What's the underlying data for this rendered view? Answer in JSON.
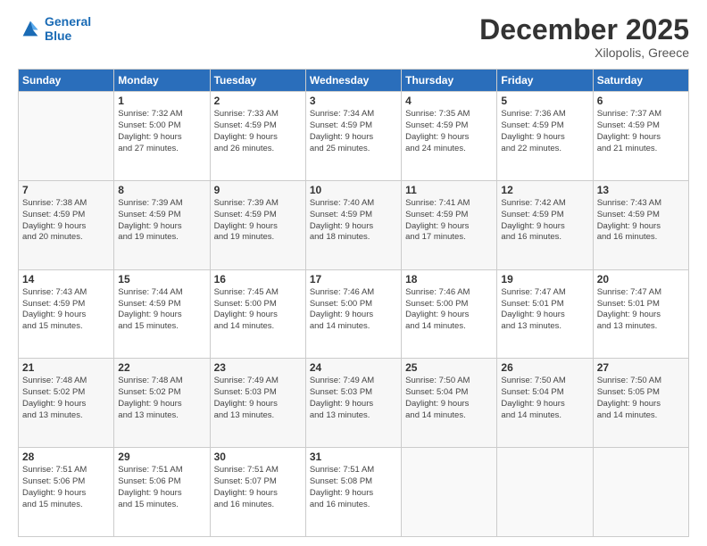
{
  "header": {
    "logo_line1": "General",
    "logo_line2": "Blue",
    "month": "December 2025",
    "location": "Xilopolis, Greece"
  },
  "days_of_week": [
    "Sunday",
    "Monday",
    "Tuesday",
    "Wednesday",
    "Thursday",
    "Friday",
    "Saturday"
  ],
  "weeks": [
    [
      {
        "day": "",
        "info": ""
      },
      {
        "day": "1",
        "info": "Sunrise: 7:32 AM\nSunset: 5:00 PM\nDaylight: 9 hours\nand 27 minutes."
      },
      {
        "day": "2",
        "info": "Sunrise: 7:33 AM\nSunset: 4:59 PM\nDaylight: 9 hours\nand 26 minutes."
      },
      {
        "day": "3",
        "info": "Sunrise: 7:34 AM\nSunset: 4:59 PM\nDaylight: 9 hours\nand 25 minutes."
      },
      {
        "day": "4",
        "info": "Sunrise: 7:35 AM\nSunset: 4:59 PM\nDaylight: 9 hours\nand 24 minutes."
      },
      {
        "day": "5",
        "info": "Sunrise: 7:36 AM\nSunset: 4:59 PM\nDaylight: 9 hours\nand 22 minutes."
      },
      {
        "day": "6",
        "info": "Sunrise: 7:37 AM\nSunset: 4:59 PM\nDaylight: 9 hours\nand 21 minutes."
      }
    ],
    [
      {
        "day": "7",
        "info": "Sunrise: 7:38 AM\nSunset: 4:59 PM\nDaylight: 9 hours\nand 20 minutes."
      },
      {
        "day": "8",
        "info": "Sunrise: 7:39 AM\nSunset: 4:59 PM\nDaylight: 9 hours\nand 19 minutes."
      },
      {
        "day": "9",
        "info": "Sunrise: 7:39 AM\nSunset: 4:59 PM\nDaylight: 9 hours\nand 19 minutes."
      },
      {
        "day": "10",
        "info": "Sunrise: 7:40 AM\nSunset: 4:59 PM\nDaylight: 9 hours\nand 18 minutes."
      },
      {
        "day": "11",
        "info": "Sunrise: 7:41 AM\nSunset: 4:59 PM\nDaylight: 9 hours\nand 17 minutes."
      },
      {
        "day": "12",
        "info": "Sunrise: 7:42 AM\nSunset: 4:59 PM\nDaylight: 9 hours\nand 16 minutes."
      },
      {
        "day": "13",
        "info": "Sunrise: 7:43 AM\nSunset: 4:59 PM\nDaylight: 9 hours\nand 16 minutes."
      }
    ],
    [
      {
        "day": "14",
        "info": "Sunrise: 7:43 AM\nSunset: 4:59 PM\nDaylight: 9 hours\nand 15 minutes."
      },
      {
        "day": "15",
        "info": "Sunrise: 7:44 AM\nSunset: 4:59 PM\nDaylight: 9 hours\nand 15 minutes."
      },
      {
        "day": "16",
        "info": "Sunrise: 7:45 AM\nSunset: 5:00 PM\nDaylight: 9 hours\nand 14 minutes."
      },
      {
        "day": "17",
        "info": "Sunrise: 7:46 AM\nSunset: 5:00 PM\nDaylight: 9 hours\nand 14 minutes."
      },
      {
        "day": "18",
        "info": "Sunrise: 7:46 AM\nSunset: 5:00 PM\nDaylight: 9 hours\nand 14 minutes."
      },
      {
        "day": "19",
        "info": "Sunrise: 7:47 AM\nSunset: 5:01 PM\nDaylight: 9 hours\nand 13 minutes."
      },
      {
        "day": "20",
        "info": "Sunrise: 7:47 AM\nSunset: 5:01 PM\nDaylight: 9 hours\nand 13 minutes."
      }
    ],
    [
      {
        "day": "21",
        "info": "Sunrise: 7:48 AM\nSunset: 5:02 PM\nDaylight: 9 hours\nand 13 minutes."
      },
      {
        "day": "22",
        "info": "Sunrise: 7:48 AM\nSunset: 5:02 PM\nDaylight: 9 hours\nand 13 minutes."
      },
      {
        "day": "23",
        "info": "Sunrise: 7:49 AM\nSunset: 5:03 PM\nDaylight: 9 hours\nand 13 minutes."
      },
      {
        "day": "24",
        "info": "Sunrise: 7:49 AM\nSunset: 5:03 PM\nDaylight: 9 hours\nand 13 minutes."
      },
      {
        "day": "25",
        "info": "Sunrise: 7:50 AM\nSunset: 5:04 PM\nDaylight: 9 hours\nand 14 minutes."
      },
      {
        "day": "26",
        "info": "Sunrise: 7:50 AM\nSunset: 5:04 PM\nDaylight: 9 hours\nand 14 minutes."
      },
      {
        "day": "27",
        "info": "Sunrise: 7:50 AM\nSunset: 5:05 PM\nDaylight: 9 hours\nand 14 minutes."
      }
    ],
    [
      {
        "day": "28",
        "info": "Sunrise: 7:51 AM\nSunset: 5:06 PM\nDaylight: 9 hours\nand 15 minutes."
      },
      {
        "day": "29",
        "info": "Sunrise: 7:51 AM\nSunset: 5:06 PM\nDaylight: 9 hours\nand 15 minutes."
      },
      {
        "day": "30",
        "info": "Sunrise: 7:51 AM\nSunset: 5:07 PM\nDaylight: 9 hours\nand 16 minutes."
      },
      {
        "day": "31",
        "info": "Sunrise: 7:51 AM\nSunset: 5:08 PM\nDaylight: 9 hours\nand 16 minutes."
      },
      {
        "day": "",
        "info": ""
      },
      {
        "day": "",
        "info": ""
      },
      {
        "day": "",
        "info": ""
      }
    ]
  ]
}
